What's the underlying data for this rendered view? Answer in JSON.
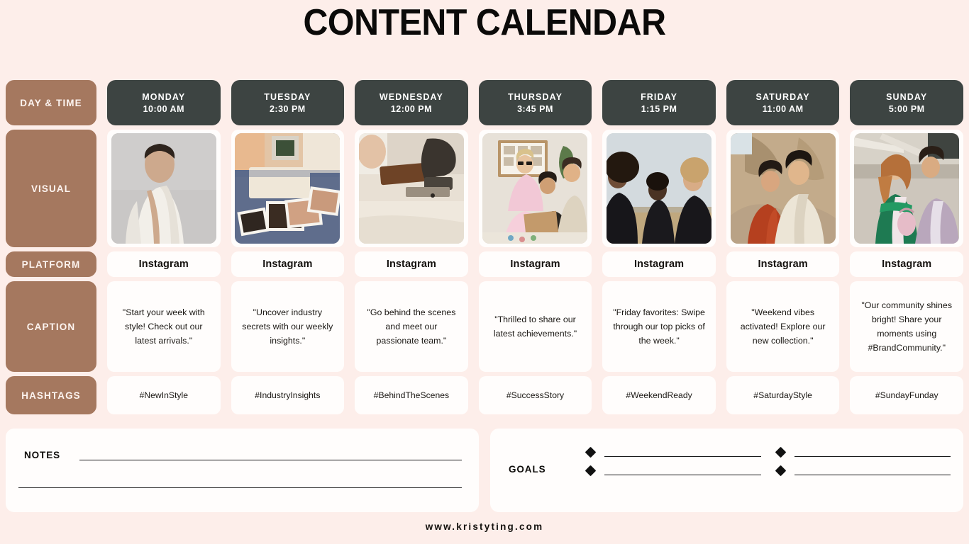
{
  "page": {
    "title": "CONTENT CALENDAR",
    "website": "www.kristyting.com",
    "background_color": "#fdeeea",
    "accent_tan": "#a5785f",
    "accent_dark": "#3d4442",
    "card_color": "#fffdfc"
  },
  "row_labels": {
    "day_time": "DAY & TIME",
    "visual": "VISUAL",
    "platform": "PLATFORM",
    "caption": "CAPTION",
    "hashtags": "HASHTAGS"
  },
  "days": [
    {
      "name": "MONDAY",
      "time": "10:00 AM",
      "platform": "Instagram",
      "caption": "\"Start your week with style! Check out our latest arrivals.\"",
      "hashtag": "#NewInStyle",
      "visual_alt": "woman-in-white-blazer-grey-background"
    },
    {
      "name": "TUESDAY",
      "time": "2:30 PM",
      "platform": "Instagram",
      "caption": "\"Uncover industry secrets with our weekly insights.\"",
      "hashtag": "#IndustryInsights",
      "visual_alt": "fashion-photo-prints-on-blue-cutting-mat"
    },
    {
      "name": "WEDNESDAY",
      "time": "12:00 PM",
      "platform": "Instagram",
      "caption": "\"Go behind the scenes and meet our passionate team.\"",
      "hashtag": "#BehindTheScenes",
      "visual_alt": "sewing-machine-with-brown-fabric"
    },
    {
      "name": "THURSDAY",
      "time": "3:45 PM",
      "platform": "Instagram",
      "caption": "\"Thrilled to share our latest achievements.\"",
      "hashtag": "#SuccessStory",
      "visual_alt": "team-working-together-in-studio"
    },
    {
      "name": "FRIDAY",
      "time": "1:15 PM",
      "platform": "Instagram",
      "caption": "\"Friday favorites: Swipe through our top picks of the week.\"",
      "hashtag": "#WeekendReady",
      "visual_alt": "three-models-in-black-against-sky"
    },
    {
      "name": "SATURDAY",
      "time": "11:00 AM",
      "platform": "Instagram",
      "caption": "\"Weekend vibes activated! Explore our new collection.\"",
      "hashtag": "#SaturdayStyle",
      "visual_alt": "couple-in-rust-and-cream-coats-by-rocks"
    },
    {
      "name": "SUNDAY",
      "time": "5:00 PM",
      "platform": "Instagram",
      "caption": "\"Our community shines bright! Share your moments using #BrandCommunity.\"",
      "hashtag": "#SundayFunday",
      "visual_alt": "woman-in-green-blazer-with-pink-bag"
    }
  ],
  "notes": {
    "label": "NOTES",
    "line_1": "",
    "line_2": ""
  },
  "goals": {
    "label": "GOALS",
    "items": [
      "",
      "",
      "",
      ""
    ]
  }
}
